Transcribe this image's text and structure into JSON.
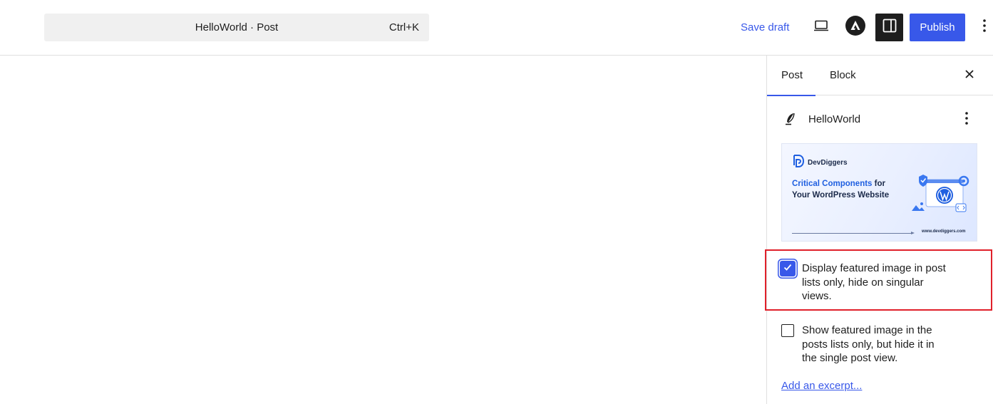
{
  "header": {
    "command_bar": {
      "title": "HelloWorld · Post",
      "shortcut": "Ctrl+K"
    },
    "save_draft_label": "Save draft",
    "publish_label": "Publish",
    "icons": [
      "laptop-preview-icon",
      "astra-logo-icon",
      "sidebar-settings-icon",
      "more-vertical-icon"
    ]
  },
  "sidebar": {
    "tabs": [
      {
        "label": "Post",
        "active": true
      },
      {
        "label": "Block",
        "active": false
      }
    ],
    "post": {
      "title": "HelloWorld",
      "icon": "feather-icon"
    },
    "featured_image": {
      "logo_text": "DevDiggers",
      "headline_accent": "Critical Components",
      "headline_rest": " for Your WordPress Website",
      "url": "www.devdiggers.com"
    },
    "options": [
      {
        "label": "Display featured image in post lists only, hide on singular views.",
        "checked": true
      },
      {
        "label": "Show featured image in the posts lists only, but hide it in the single post view.",
        "checked": false
      }
    ],
    "excerpt_link": "Add an excerpt..."
  },
  "colors": {
    "accent": "#3858e9",
    "highlight": "#e0202a",
    "dark": "#1e1e1e"
  }
}
